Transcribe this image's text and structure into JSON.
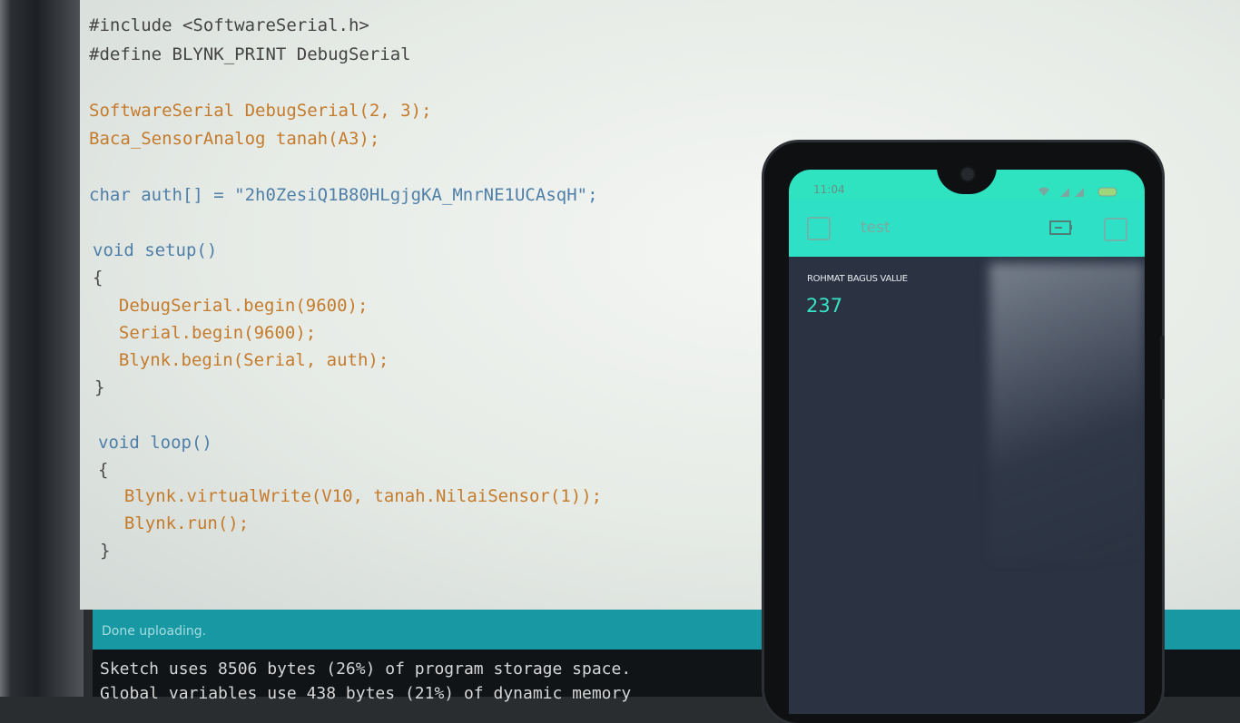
{
  "editor": {
    "lines": [
      "#include <SoftwareSerial.h>",
      "#define BLYNK_PRINT DebugSerial",
      "SoftwareSerial DebugSerial(2, 3);",
      "Baca_SensorAnalog tanah(A3);",
      "char auth[] = \"2h0ZesiQ1B80HLgjgKA_MnrNE1UCAsqH\";",
      "void setup()",
      "{",
      "  DebugSerial.begin(9600);",
      "  Serial.begin(9600);",
      "  Blynk.begin(Serial, auth);",
      "}",
      "void loop()",
      "{",
      "  Blynk.virtualWrite(V10, tanah.NilaiSensor(1));",
      "  Blynk.run();",
      "}"
    ]
  },
  "status": {
    "message": "Done uploading."
  },
  "console": {
    "lines": [
      "Sketch uses 8506 bytes (26%) of program storage space.",
      "Global variables use 438 bytes (21%) of dynamic memory"
    ]
  },
  "phone": {
    "time": "11:04",
    "app_title": "test",
    "widget_label": "ROHMAT BAGUS VALUE",
    "widget_value": "237",
    "icons": {
      "menu": "menu-icon",
      "device": "device-icon",
      "add": "add-widget-icon",
      "signal": "signal-icon",
      "wifi": "wifi-icon",
      "battery": "battery-icon"
    },
    "accent": "#2ee0c6"
  }
}
